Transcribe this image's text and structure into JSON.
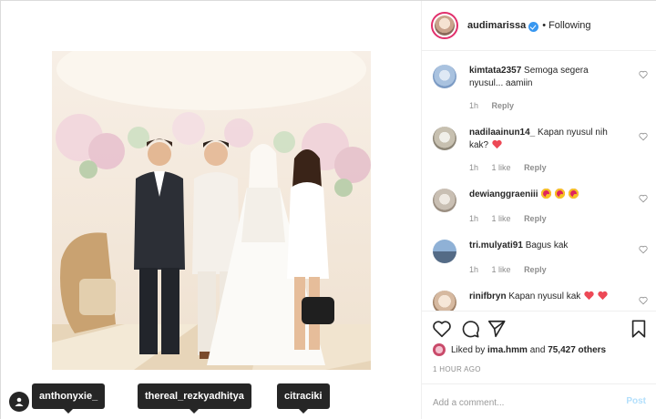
{
  "header": {
    "username": "audimarissa",
    "separator": "•",
    "follow_status": "Following"
  },
  "comments": [
    {
      "user": "kimtata2357",
      "text": "Semoga segera nyusul... aamiin",
      "time": "1h",
      "likes": "",
      "reply": "Reply"
    },
    {
      "user": "nadilaainun14_",
      "text": "Kapan nyusul nih kak?",
      "time": "1h",
      "likes": "1 like",
      "reply": "Reply",
      "emoji": [
        "heart"
      ]
    },
    {
      "user": "dewianggraeniii",
      "text": "",
      "time": "1h",
      "likes": "1 like",
      "reply": "Reply",
      "emoji": [
        "heart-eyes",
        "heart-eyes",
        "heart-eyes"
      ]
    },
    {
      "user": "tri.mulyati91",
      "text": "Bagus kak",
      "time": "1h",
      "likes": "1 like",
      "reply": "Reply"
    },
    {
      "user": "rinifbryn",
      "text": "Kapan nyusul kak",
      "time": "",
      "likes": "",
      "reply": "",
      "emoji": [
        "heart",
        "heart"
      ]
    }
  ],
  "likes": {
    "prefix": "Liked by",
    "user": "ima.hmm",
    "middle": "and",
    "others": "75,427 others"
  },
  "timestamp": "1 HOUR AGO",
  "comment_input": {
    "placeholder": "Add a comment..."
  },
  "post_button": "Post",
  "tags": [
    "anthonyxie_",
    "thereal_rezkyadhitya",
    "citraciki"
  ],
  "photo": {
    "watermark": ""
  },
  "colors": {
    "verified": "#3897f0",
    "heart": "#ed4956",
    "link": "#b2dffc",
    "muted": "#8e8e8e"
  }
}
